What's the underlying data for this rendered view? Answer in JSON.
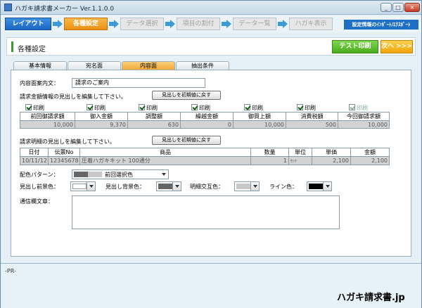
{
  "window": {
    "title": "ハガキ請求書メーカー Ver.1.1.0.0",
    "min": "_",
    "max": "□",
    "close": "×"
  },
  "wizard": {
    "steps": [
      "レイアウト",
      "各種設定",
      "データ選択",
      "項目の割付",
      "データ一覧",
      "ハガキ表示"
    ],
    "right_button": "設定情報のｲﾝﾎﾟｰﾄ/ｴｸｽﾎﾟｰﾄ"
  },
  "header": {
    "title": "各種設定",
    "test_print": "テスト印刷",
    "next": "次へ >>>"
  },
  "tabs": [
    "基本情報",
    "宛名面",
    "内容面",
    "抽出条件"
  ],
  "content": {
    "guide_label": "内容面案内文：",
    "guide_value": "請求のご案内",
    "amount_caption": "請求金額情報の見出しを編集して下さい。",
    "reset_label": "見出しを初期値に戻す",
    "print_label": "印刷",
    "amount_headers": [
      "前回御請求額",
      "御入金額",
      "調整額",
      "繰越金額",
      "御買上額",
      "消費税額",
      "今回御請求額"
    ],
    "amount_values": [
      "10,000",
      "9,370",
      "630",
      "0",
      "10,000",
      "500",
      "10,000"
    ],
    "detail_caption": "請求明細の見出しを編集して下さい。",
    "detail_headers": [
      "日付",
      "伝票No",
      "商品",
      "数量",
      "単位",
      "単価",
      "金額"
    ],
    "detail_values": [
      "10/11/12",
      "12345678",
      "圧着ハガキキット 100通分",
      "1",
      "ｾｯﾄ",
      "2,100",
      "2,100"
    ],
    "color_pattern_label": "配色パターン：",
    "color_pattern_value": "前回選択色",
    "fg_label": "見出し前景色：",
    "bg_label": "見出し背景色：",
    "alt_label": "明細交互色：",
    "line_label": "ライン色：",
    "memo_label": "通信欄文章："
  },
  "colors": {
    "fg": "#ffffff",
    "bg": "#666666",
    "alt": "#c8c8c8",
    "line": "#000000"
  },
  "footer": {
    "pr": "-PR-",
    "brand": "ハガキ請求書.jp"
  }
}
